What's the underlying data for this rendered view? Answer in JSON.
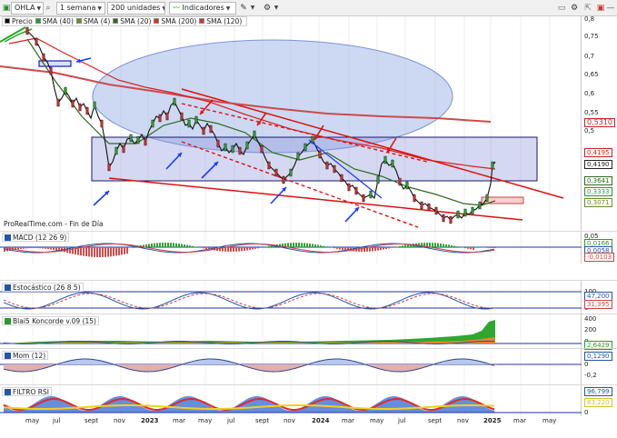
{
  "toolbar": {
    "symbol": "OHLA",
    "timeframe": "1 semana",
    "units": "200 unidades",
    "indicators_label": "Indicadores"
  },
  "legend": [
    {
      "label": "Precio",
      "color": "#000000"
    },
    {
      "label": "SMA (40)",
      "color": "#1f9e2f"
    },
    {
      "label": "SMA (4)",
      "color": "#6b8e23"
    },
    {
      "label": "SMA (20)",
      "color": "#2e6b1e"
    },
    {
      "label": "SMA (200)",
      "color": "#e0302a"
    },
    {
      "label": "SMA (120)",
      "color": "#c43a3a"
    }
  ],
  "price_axis": {
    "ticks": [
      "0,8",
      "0,75",
      "0,7",
      "0,65",
      "0,6",
      "0,55",
      "0,5"
    ],
    "tags": [
      {
        "text": "0,5310",
        "color": "#cc2222"
      },
      {
        "text": "0,4195",
        "color": "#cc2222"
      },
      {
        "text": "0,4190",
        "color": "#222222"
      },
      {
        "text": "0,3641",
        "color": "#2e6b1e"
      },
      {
        "text": "0,3333",
        "color": "#1f9e2f"
      },
      {
        "text": "0,3071",
        "color": "#6b8e23"
      }
    ]
  },
  "footer_note": "ProRealTime.com - Fin de Día",
  "panels": {
    "macd": {
      "label": "MACD (12 26 9)",
      "ticks": [
        "0,05",
        "0",
        "-0,05"
      ],
      "tags": [
        {
          "text": "0,0166",
          "color": "#2b9a2b"
        },
        {
          "text": "0,0058",
          "color": "#2255aa"
        },
        {
          "text": "-0,0103",
          "color": "#cc4444"
        }
      ]
    },
    "stoch": {
      "label": "Estocástico (26 8 5)",
      "ticks": [
        "100",
        "0"
      ],
      "tags": [
        {
          "text": "47,200",
          "color": "#2255aa"
        },
        {
          "text": "31,395",
          "color": "#cc4444"
        }
      ]
    },
    "blai": {
      "label": "Blai5 Koncorde v.09 (15)",
      "ticks": [
        "400",
        "200",
        "0"
      ],
      "tags": [
        {
          "text": "2,6429",
          "color": "#2b9a2b"
        }
      ]
    },
    "mom": {
      "label": "Mom (12)",
      "ticks": [
        "0,2",
        "0",
        "-0,2"
      ],
      "tags": [
        {
          "text": "0,1290",
          "color": "#2255aa"
        }
      ]
    },
    "rsi": {
      "label": "FILTRO RSI",
      "ticks": [
        "0"
      ],
      "tags": [
        {
          "text": "96,799",
          "color": "#2255aa"
        },
        {
          "text": "83,220",
          "color": "#e0c020"
        }
      ]
    }
  },
  "x_axis": [
    {
      "label": "may",
      "year": false
    },
    {
      "label": "jul",
      "year": false
    },
    {
      "label": "sept",
      "year": false
    },
    {
      "label": "nov",
      "year": false
    },
    {
      "label": "2023",
      "year": true
    },
    {
      "label": "mar",
      "year": false
    },
    {
      "label": "may",
      "year": false
    },
    {
      "label": "jul",
      "year": false
    },
    {
      "label": "sept",
      "year": false
    },
    {
      "label": "nov",
      "year": false
    },
    {
      "label": "2024",
      "year": true
    },
    {
      "label": "mar",
      "year": false
    },
    {
      "label": "may",
      "year": false
    },
    {
      "label": "jul",
      "year": false
    },
    {
      "label": "sept",
      "year": false
    },
    {
      "label": "nov",
      "year": false
    },
    {
      "label": "2025",
      "year": true
    },
    {
      "label": "mar",
      "year": false
    },
    {
      "label": "may",
      "year": false
    }
  ],
  "colors": {
    "rect_fill": "#8890d8",
    "rect_stroke": "#1a1a6a",
    "ellipse_fill": "#9bb4e8",
    "channel": "#e01010",
    "arrow_blue": "#1a3cff",
    "arrow_red": "#e01010"
  }
}
